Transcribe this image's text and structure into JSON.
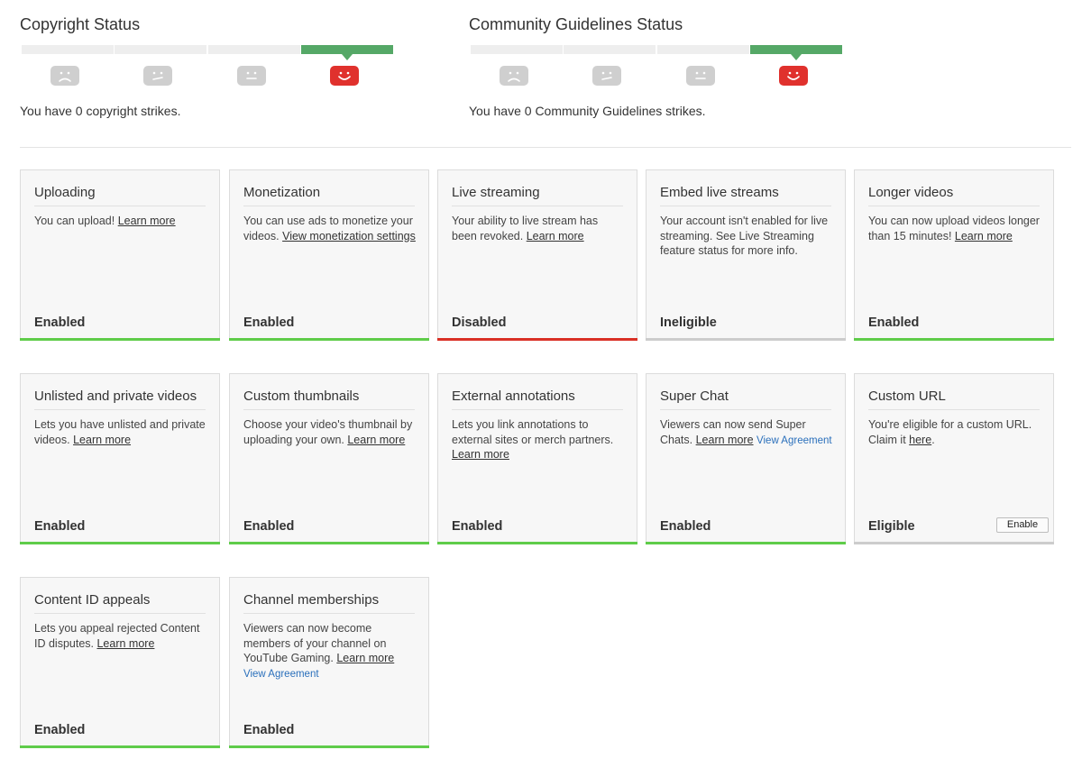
{
  "copyright": {
    "title": "Copyright Status",
    "message": "You have 0 copyright strikes.",
    "faces": [
      "sad-face-icon",
      "meh-face-icon",
      "neutral-face-icon",
      "happy-face-icon"
    ],
    "active_level": 4
  },
  "community": {
    "title": "Community Guidelines Status",
    "message": "You have 0 Community Guidelines strikes.",
    "faces": [
      "sad-face-icon",
      "meh-face-icon",
      "neutral-face-icon",
      "happy-face-icon"
    ],
    "active_level": 4
  },
  "colors": {
    "enabled": "#5fcc4a",
    "disabled": "#d93025",
    "ineligible": "#cccccc",
    "meter_active": "#55a867",
    "face_active": "#e0312d"
  },
  "features": [
    {
      "title": "Uploading",
      "desc": [
        {
          "t": "You can upload! "
        },
        {
          "t": "Learn more",
          "link": true
        }
      ],
      "status": "Enabled",
      "state": "enabled"
    },
    {
      "title": "Monetization",
      "desc": [
        {
          "t": "You can use ads to monetize your videos. "
        },
        {
          "t": "View monetization settings",
          "link": true
        }
      ],
      "status": "Enabled",
      "state": "enabled"
    },
    {
      "title": "Live streaming",
      "desc": [
        {
          "t": "Your ability to live stream has been revoked. "
        },
        {
          "t": "Learn more",
          "link": true
        }
      ],
      "status": "Disabled",
      "state": "disabled"
    },
    {
      "title": "Embed live streams",
      "desc": [
        {
          "t": "Your account isn't enabled for live streaming. See Live Streaming feature status for more info."
        }
      ],
      "status": "Ineligible",
      "state": "ineligible"
    },
    {
      "title": "Longer videos",
      "desc": [
        {
          "t": "You can now upload videos longer than 15 minutes! "
        },
        {
          "t": "Learn more",
          "link": true
        }
      ],
      "status": "Enabled",
      "state": "enabled"
    },
    {
      "title": "Unlisted and private videos",
      "desc": [
        {
          "t": "Lets you have unlisted and private videos. "
        },
        {
          "t": "Learn more",
          "link": true
        }
      ],
      "status": "Enabled",
      "state": "enabled"
    },
    {
      "title": "Custom thumbnails",
      "desc": [
        {
          "t": "Choose your video's thumbnail by uploading your own. "
        },
        {
          "t": "Learn more",
          "link": true
        }
      ],
      "status": "Enabled",
      "state": "enabled"
    },
    {
      "title": "External annotations",
      "desc": [
        {
          "t": "Lets you link annotations to external sites or merch partners. "
        },
        {
          "t": "Learn more",
          "link": true
        }
      ],
      "status": "Enabled",
      "state": "enabled"
    },
    {
      "title": "Super Chat",
      "desc": [
        {
          "t": "Viewers can now send Super Chats. "
        },
        {
          "t": "Learn more",
          "link": true
        },
        {
          "t": " "
        },
        {
          "t": "View Agreement",
          "blue": true
        }
      ],
      "status": "Enabled",
      "state": "enabled"
    },
    {
      "title": "Custom URL",
      "desc": [
        {
          "t": "You're eligible for a custom URL. Claim it "
        },
        {
          "t": "here",
          "link": true
        },
        {
          "t": "."
        }
      ],
      "status": "Eligible",
      "state": "ineligible",
      "button": "Enable"
    },
    {
      "title": "Content ID appeals",
      "desc": [
        {
          "t": "Lets you appeal rejected Content ID disputes. "
        },
        {
          "t": "Learn more",
          "link": true
        }
      ],
      "status": "Enabled",
      "state": "enabled"
    },
    {
      "title": "Channel memberships",
      "desc": [
        {
          "t": "Viewers can now become members of your channel on YouTube Gaming. "
        },
        {
          "t": "Learn more",
          "link": true
        },
        {
          "br": true
        },
        {
          "t": "View Agreement",
          "blue": true
        }
      ],
      "status": "Enabled",
      "state": "enabled"
    }
  ]
}
